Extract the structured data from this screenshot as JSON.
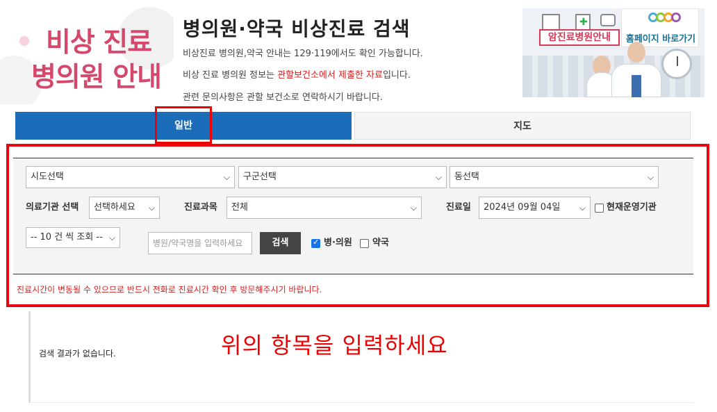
{
  "logo": {
    "line1": "비상 진료",
    "line2": "병의원 안내"
  },
  "header": {
    "title": "병의원·약국 비상진료 검색",
    "info1": "비상진료 병의원,약국 안내는 129·119에서도 확인 가능합니다.",
    "info2_prefix": "비상 진료 병의원 정보는 ",
    "info2_highlight": "관할보건소에서 제출한 자료",
    "info2_suffix": "입니다.",
    "info3": "관련 문의사항은 관할 보건소로 연락하시기 바랍니다."
  },
  "banner": {
    "left_button": "암진료병원안내",
    "right_button": "홈페이지 바로가기"
  },
  "tabs": [
    {
      "label": "일반",
      "active": true
    },
    {
      "label": "지도",
      "active": false
    }
  ],
  "filters": {
    "sido": "시도선택",
    "gugun": "구군선택",
    "dong": "동선택",
    "facility_type_label": "의료기관 선택",
    "facility_type_value": "선택하세요",
    "department_label": "진료과목",
    "department_value": "전체",
    "date_label": "진료일",
    "date_value": "2024년 09월 04일",
    "open_now_label": "현재운영기관",
    "open_now_checked": false,
    "rows_value": "-- 10 건 씩 조회 --",
    "search_placeholder": "병원/약국명을 입력하세요",
    "search_button": "검색",
    "clinic_label": "병·의원",
    "clinic_checked": true,
    "pharmacy_label": "약국",
    "pharmacy_checked": false
  },
  "notice": "진료시간이 변동될 수 있으므로 반드시 전화로 진료시간 확인 후 방문해주시기 바랍니다.",
  "results": {
    "empty_message": "검색 결과가 없습니다."
  },
  "annotation": "위의 항목을 입력하세요",
  "colors": {
    "accent": "#1b6cb9",
    "highlight": "#e8050f",
    "brand_pink": "#d4486c",
    "warning_text": "#d71f1f"
  }
}
